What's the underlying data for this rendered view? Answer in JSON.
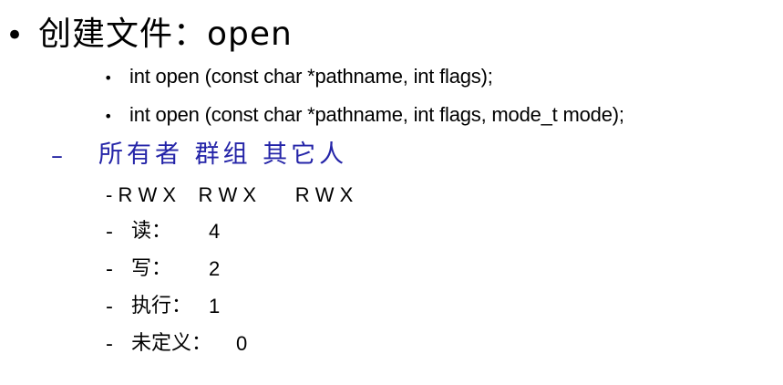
{
  "slide": {
    "title": "创建文件：open",
    "bullet_symbol": "•",
    "signatures": [
      "int open (const char *pathname,  int flags);",
      "int open (const char *pathname,  int flags, mode_t  mode);"
    ],
    "owner_header": {
      "dash": "–",
      "text": "所有者   群组   其它人"
    },
    "rwx_line": "- R W X    R W X       R W X",
    "permissions": [
      {
        "dash": "-",
        "label": "读：",
        "value": "4"
      },
      {
        "dash": "-",
        "label": "写：",
        "value": "2"
      },
      {
        "dash": "-",
        "label": "执行：",
        "value": "1"
      },
      {
        "dash": "-",
        "label": "未定义：",
        "value": "0"
      }
    ],
    "colors": {
      "text": "#000000",
      "accent_blue": "#2424a8",
      "background": "#ffffff"
    }
  }
}
